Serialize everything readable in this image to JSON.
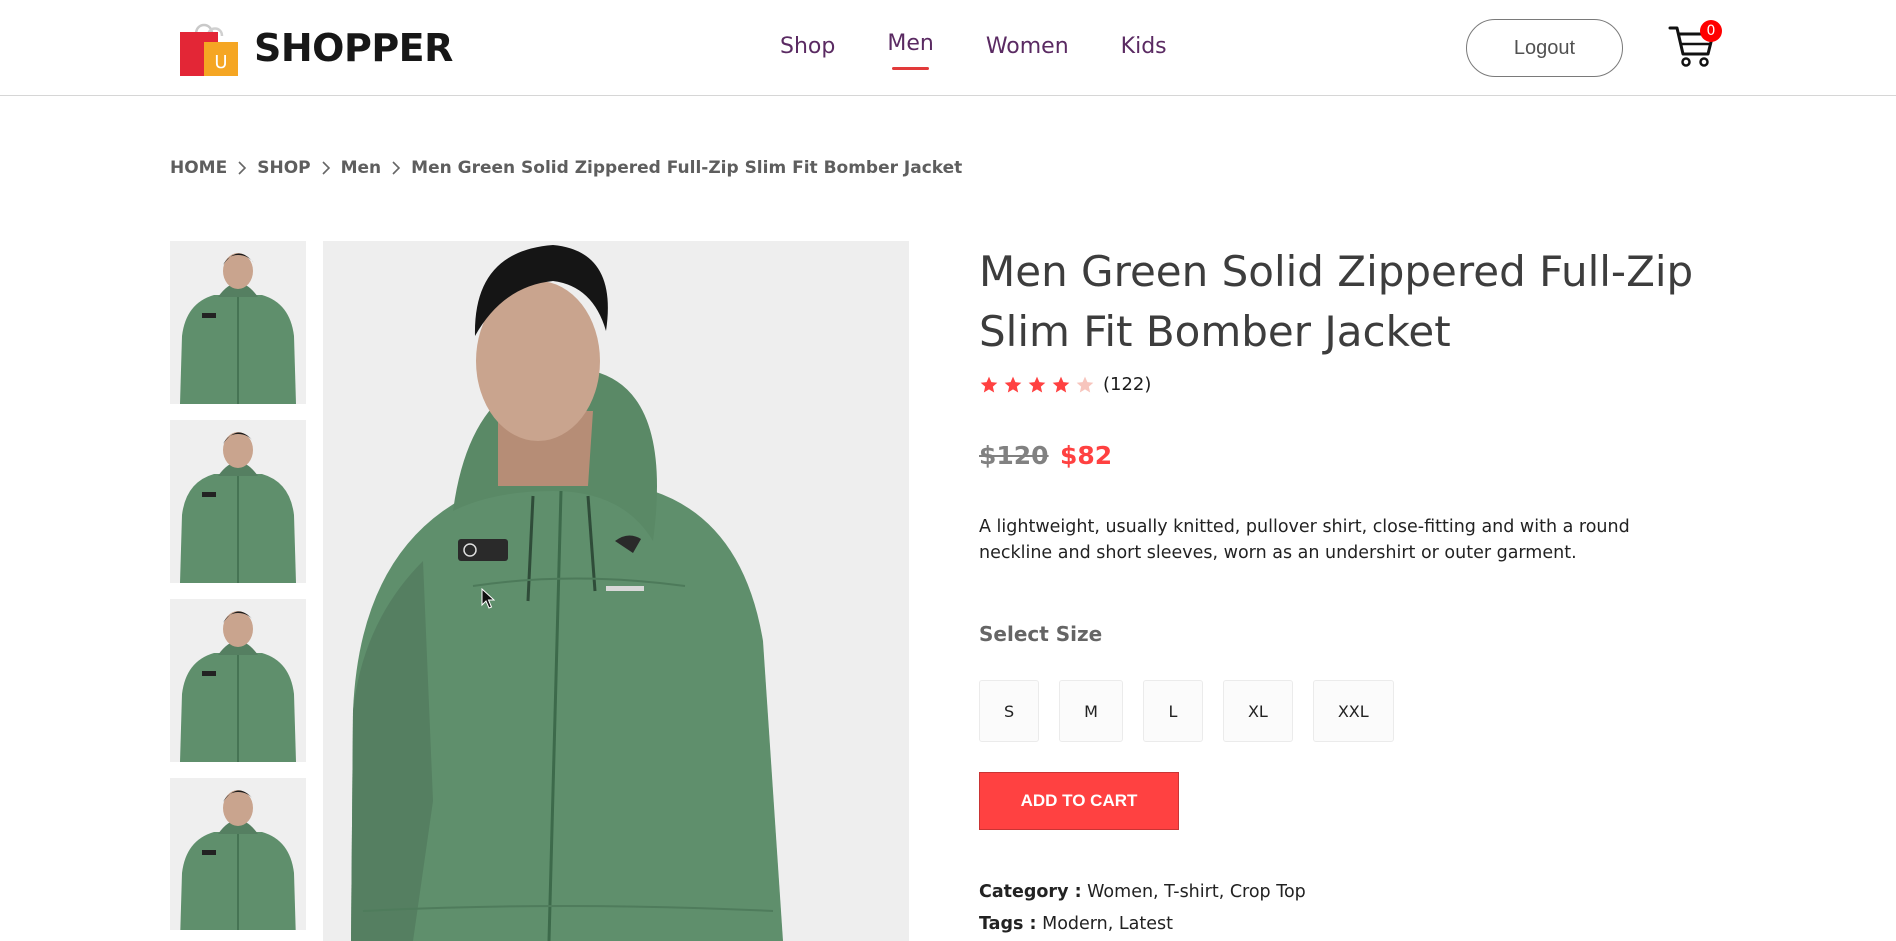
{
  "navbar": {
    "logo_text": "SHOPPER",
    "logo_bag_letter": "U",
    "menu": [
      {
        "label": "Shop",
        "active": false
      },
      {
        "label": "Men",
        "active": true
      },
      {
        "label": "Women",
        "active": false
      },
      {
        "label": "Kids",
        "active": false
      }
    ],
    "logout_label": "Logout",
    "cart_count": "0"
  },
  "breadcrumb": [
    "HOME",
    "SHOP",
    "Men",
    "Men Green Solid Zippered Full-Zip Slim Fit Bomber Jacket"
  ],
  "product": {
    "title": "Men Green Solid Zippered Full-Zip Slim Fit Bomber Jacket",
    "rating": 4,
    "rating_max": 5,
    "review_count": "(122)",
    "old_price": "$120",
    "new_price": "$82",
    "description": "A lightweight, usually knitted, pullover shirt, close-fitting and with a round neckline and short sleeves, worn as an undershirt or outer garment.",
    "size_heading": "Select Size",
    "sizes": [
      "S",
      "M",
      "L",
      "XL",
      "XXL"
    ],
    "add_to_cart_label": "ADD TO CART",
    "category_label": "Category :",
    "category_value": "Women, T-shirt, Crop Top",
    "tags_label": "Tags :",
    "tags_value": "Modern, Latest"
  },
  "colors": {
    "accent": "#ff4141",
    "nav_text": "#5a2a62",
    "jacket_green": "#5f8f6c",
    "star": "#ff4141"
  }
}
